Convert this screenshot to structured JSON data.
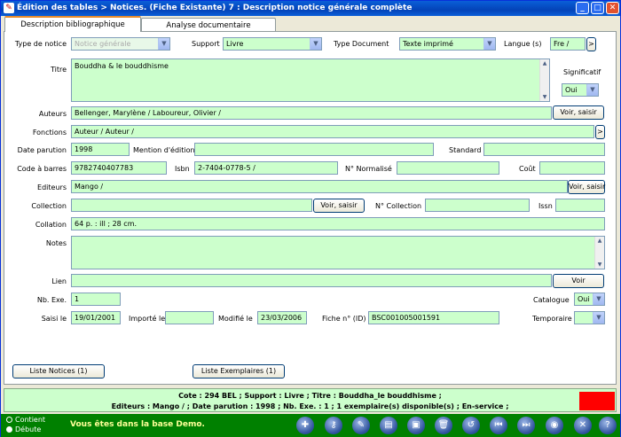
{
  "window": {
    "title": "Édition des tables > Notices.  (Fiche Existante) 7  : Description notice générale complète"
  },
  "tabs": [
    "Description bibliographique",
    "Analyse documentaire"
  ],
  "form": {
    "type_notice_label": "Type de notice",
    "type_notice": "Notice générale",
    "support_label": "Support",
    "support": "Livre",
    "type_doc_label": "Type Document",
    "type_doc": "Texte imprimé",
    "langue_label": "Langue (s)",
    "langue": "Fre /",
    "langue_btn": ">",
    "titre_label": "Titre",
    "titre": "Bouddha & le bouddhisme",
    "significatif_label": "Significatif",
    "significatif": "Oui",
    "auteurs_label": "Auteurs",
    "auteurs": "Bellenger, Marylène / Laboureur, Olivier /",
    "auteurs_btn": "Voir, saisir",
    "fonctions_label": "Fonctions",
    "fonctions": "Auteur / Auteur /",
    "fonctions_btn": ">",
    "date_parution_label": "Date parution",
    "date_parution": "1998",
    "mention_label": "Mention d'édition",
    "mention": "",
    "standard_label": "Standard",
    "standard": "",
    "code_barres_label": "Code à barres",
    "code_barres": "9782740407783",
    "isbn_label": "Isbn",
    "isbn": "2-7404-0778-5 /",
    "normalise_label": "N° Normalisé",
    "normalise": "",
    "cout_label": "Coût",
    "cout": "",
    "editeurs_label": "Editeurs",
    "editeurs": "Mango /",
    "editeurs_btn": "Voir, saisir",
    "collection_label": "Collection",
    "collection": "",
    "collection_btn": "Voir, saisir",
    "num_collection_label": "N° Collection",
    "num_collection": "",
    "issn_label": "Issn",
    "issn": "",
    "collation_label": "Collation",
    "collation": "64 p. : ill ; 28 cm.",
    "notes_label": "Notes",
    "notes": "",
    "lien_label": "Lien",
    "lien": "",
    "lien_btn": "Voir",
    "nb_exe_label": "Nb. Exe.",
    "nb_exe": "1",
    "catalogue_label": "Catalogue",
    "catalogue": "Oui",
    "saisi_label": "Saisi le",
    "saisi": "19/01/2001",
    "importe_label": "Importé le",
    "importe": "",
    "modifie_label": "Modifié le",
    "modifie": "23/03/2006",
    "fiche_label": "Fiche n° (ID)",
    "fiche": "BSC001005001591",
    "temporaire_label": "Temporaire",
    "temporaire": ""
  },
  "buttons": {
    "liste_notices": "Liste Notices    (1)",
    "liste_exemplaires": "Liste Exemplaires    (1)"
  },
  "status": {
    "line1": "Cote  : 294 BEL ;  Support  : Livre ;  Titre  : Bouddha_le bouddhisme ;",
    "line2": "Editeurs  : Mango / ;  Date parution  : 1998 ;  Nb. Exe.  : 1 ; 1 exemplaire(s) disponible(s)  ;   En-service  ;"
  },
  "bottom": {
    "radio1": "Contient",
    "radio2": "Débute",
    "demo": "Vous êtes dans la base Demo."
  }
}
